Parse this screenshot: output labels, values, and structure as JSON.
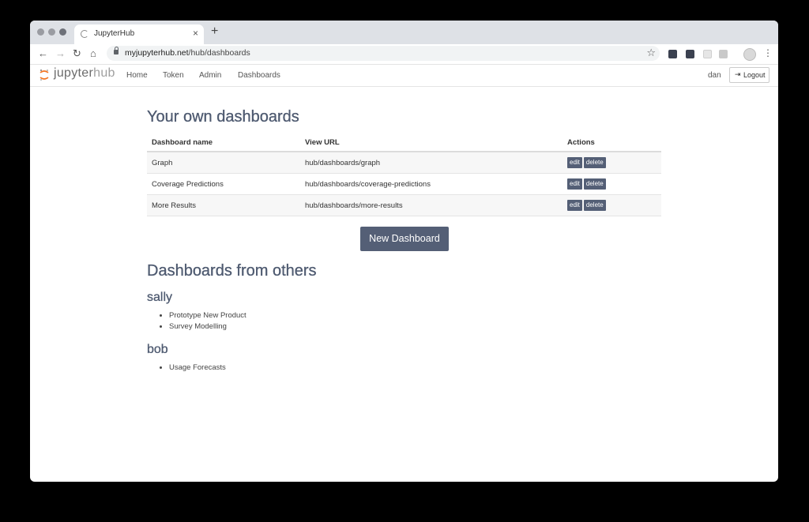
{
  "browser": {
    "tab_title": "JupyterHub",
    "tab_close": "×",
    "new_tab": "+",
    "url_host": "myjupyterhub.net",
    "url_path": "/hub/dashboards",
    "back": "←",
    "forward": "→",
    "reload": "↻",
    "home": "⌂",
    "star": "☆",
    "menu": "⋮"
  },
  "header": {
    "logo_jupyter": "jupyter",
    "logo_hub": "hub",
    "nav": [
      "Home",
      "Token",
      "Admin",
      "Dashboards"
    ],
    "user": "dan",
    "logout_label": "Logout",
    "logout_icon": "⇥"
  },
  "own": {
    "title": "Your own dashboards",
    "columns": [
      "Dashboard name",
      "View URL",
      "Actions"
    ],
    "rows": [
      {
        "name": "Graph",
        "url": "hub/dashboards/graph",
        "edit": "edit",
        "delete": "delete"
      },
      {
        "name": "Coverage Predictions",
        "url": "hub/dashboards/coverage-predictions",
        "edit": "edit",
        "delete": "delete"
      },
      {
        "name": "More Results",
        "url": "hub/dashboards/more-results",
        "edit": "edit",
        "delete": "delete"
      }
    ],
    "new_button": "New Dashboard"
  },
  "others": {
    "title": "Dashboards from others",
    "groups": [
      {
        "user": "sally",
        "items": [
          "Prototype New Product",
          "Survey Modelling"
        ]
      },
      {
        "user": "bob",
        "items": [
          "Usage Forecasts"
        ]
      }
    ]
  },
  "colors": {
    "accent": "#545f76",
    "heading": "#4e5a70"
  }
}
